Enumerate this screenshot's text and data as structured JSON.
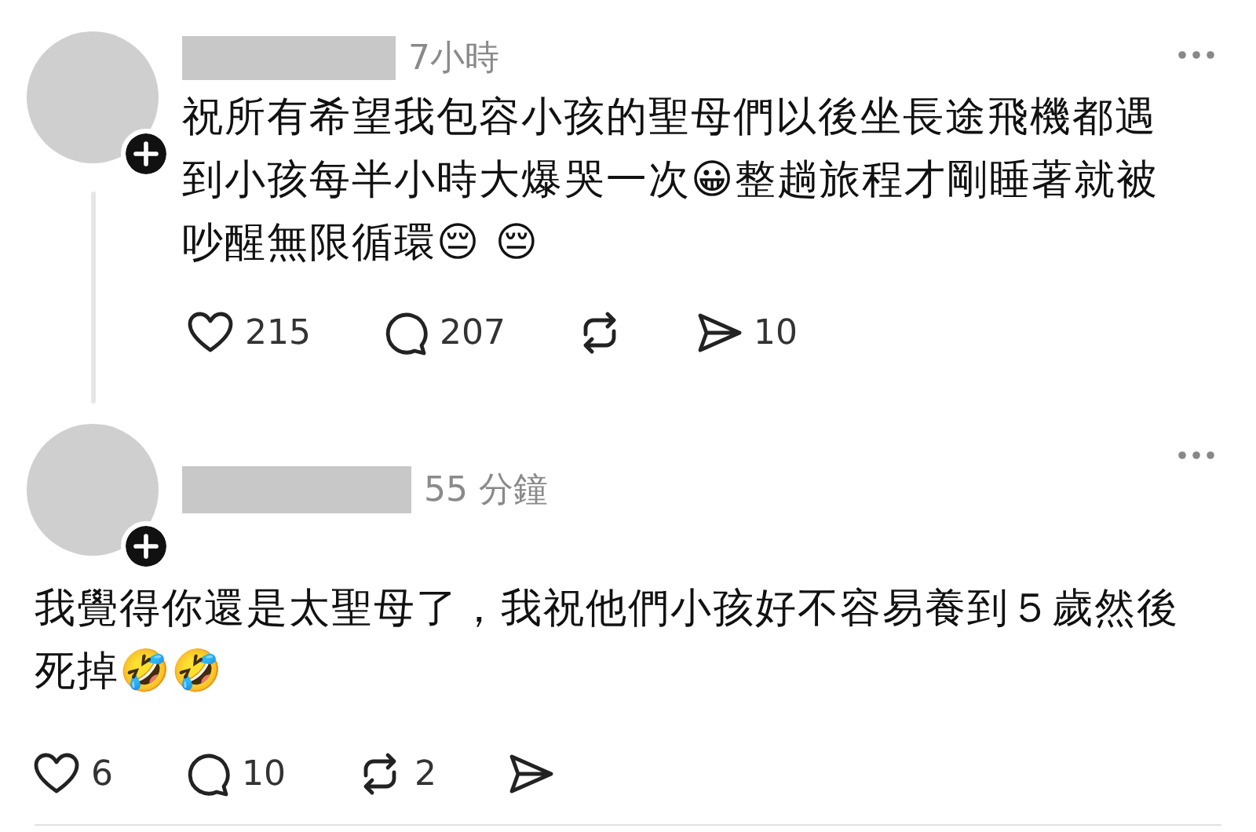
{
  "posts": [
    {
      "time": "7小時",
      "thread_line": true,
      "text": "祝所有希望我包容小孩的聖母們以後坐長途飛機都遇到小孩每半小時大爆哭一次😀整趟旅程才剛睡著就被吵醒無限循環😔 😔",
      "actions": [
        {
          "kind": "like",
          "count": "215"
        },
        {
          "kind": "comment",
          "count": "207"
        },
        {
          "kind": "repost"
        },
        {
          "kind": "share",
          "count": "10"
        }
      ]
    },
    {
      "time": "55 分鐘",
      "thread_line": false,
      "text": "我覺得你還是太聖母了，我祝他們小孩好不容易養到５歲然後死掉🤣🤣",
      "actions": [
        {
          "kind": "like",
          "count": "6"
        },
        {
          "kind": "comment",
          "count": "10"
        },
        {
          "kind": "repost",
          "count": "2"
        },
        {
          "kind": "share"
        }
      ]
    }
  ]
}
